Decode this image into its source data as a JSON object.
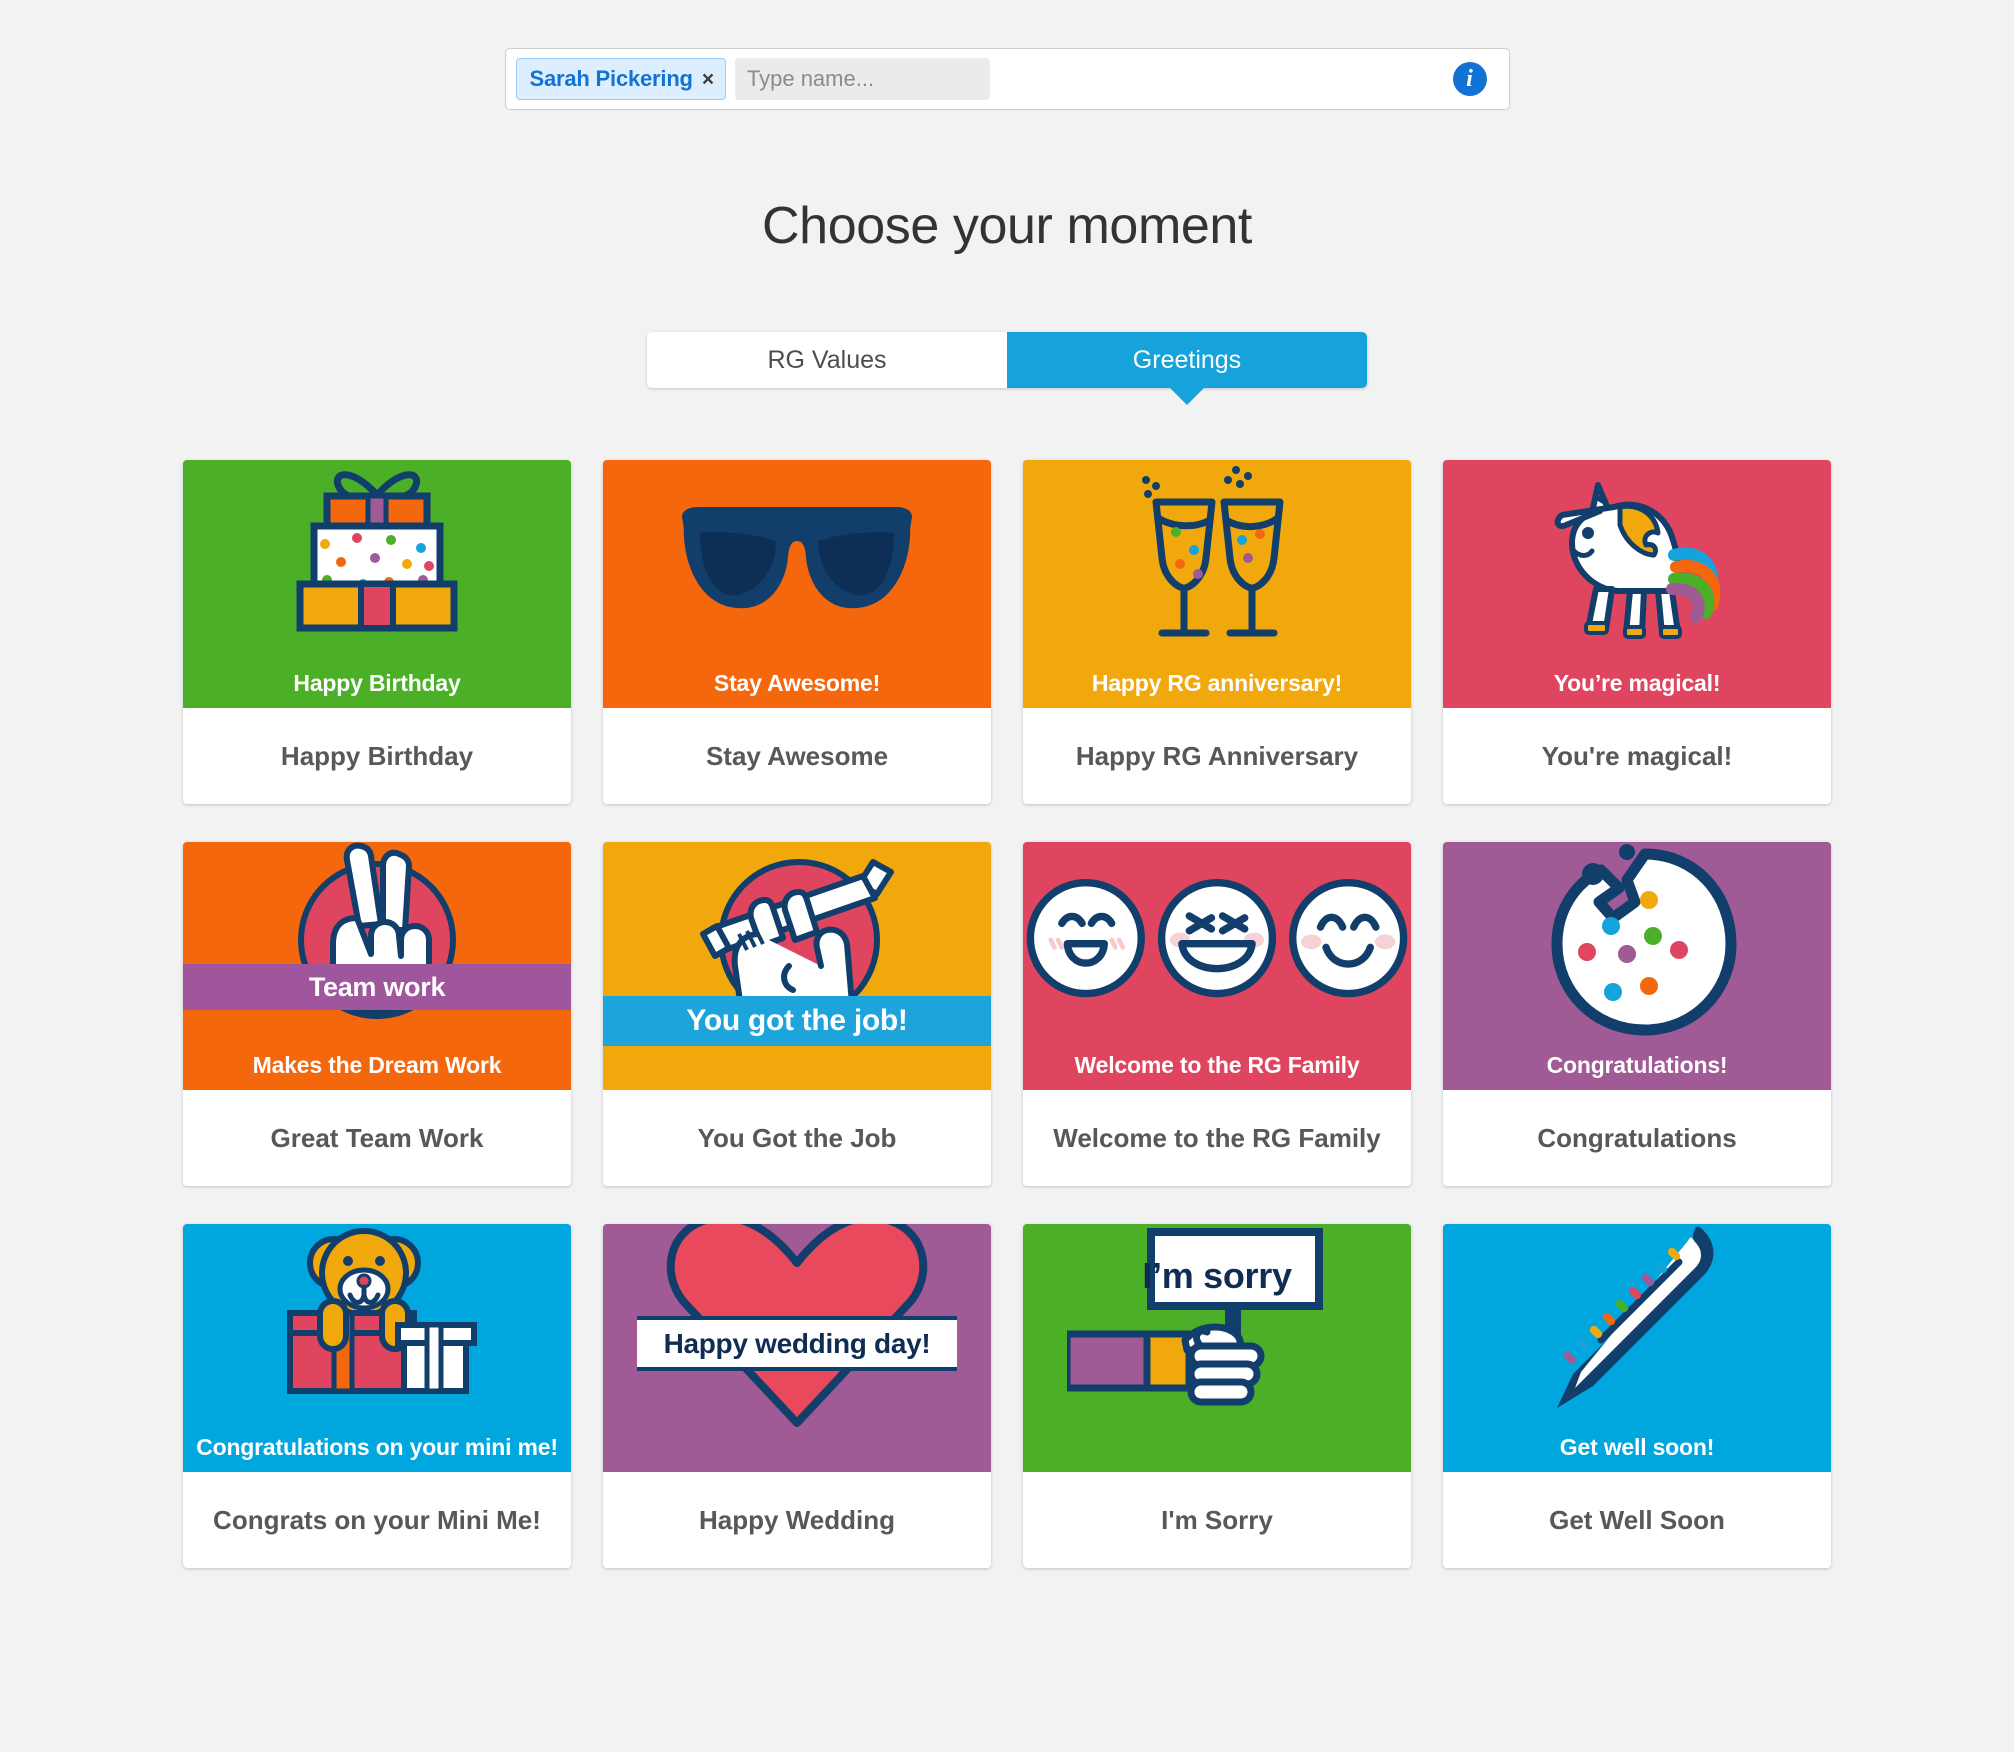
{
  "recipient_bar": {
    "chip_name": "Sarah Pickering",
    "chip_remove_glyph": "×",
    "input_placeholder": "Type name...",
    "input_value": "",
    "info_glyph": "i"
  },
  "page_title": "Choose your moment",
  "tabs": [
    {
      "label": "RG Values",
      "active": false
    },
    {
      "label": "Greetings",
      "active": true
    }
  ],
  "colors": {
    "page_bg": "#f2f2f2",
    "accent_blue": "#16a3dc",
    "chip_blue": "#1273d4",
    "ink_navy": "#123e6b",
    "green": "#4caf28",
    "orange": "#f4670c",
    "amber": "#f0a80c",
    "crimson": "#e04560",
    "purple": "#a05a96",
    "sky": "#00a6de"
  },
  "cards": [
    {
      "label": "Happy Birthday",
      "caption": "Happy Birthday",
      "bg": "#4caf28",
      "art": "gift-stack-icon"
    },
    {
      "label": "Stay Awesome",
      "caption": "Stay Awesome!",
      "bg": "#f4670c",
      "art": "sunglasses-icon"
    },
    {
      "label": "Happy RG Anniversary",
      "caption": "Happy RG anniversary!",
      "bg": "#f0a80c",
      "art": "champagne-glasses-icon"
    },
    {
      "label": "You're magical!",
      "caption": "You’re magical!",
      "bg": "#e04560",
      "art": "unicorn-icon"
    },
    {
      "label": "Great Team Work",
      "caption": "Makes the Dream Work",
      "bg": "#f4670c",
      "art": "peace-hand-icon",
      "banner": "Team work"
    },
    {
      "label": "You Got the Job",
      "caption": "",
      "bg": "#f0a80c",
      "art": "fist-pencil-icon",
      "banner": "You got the job!"
    },
    {
      "label": "Welcome to the RG Family",
      "caption": "Welcome to the RG Family",
      "bg": "#e04560",
      "art": "three-smileys-icon"
    },
    {
      "label": "Congratulations",
      "caption": "Congratulations!",
      "bg": "#a05a96",
      "art": "cookie-icon"
    },
    {
      "label": "Congrats on your Mini Me!",
      "caption": "Congratulations on your mini me!",
      "bg": "#00a6de",
      "art": "teddy-gift-icon"
    },
    {
      "label": "Happy Wedding",
      "caption": "",
      "bg": "#a05a96",
      "art": "heart-icon",
      "banner": "Happy wedding day!"
    },
    {
      "label": "I'm Sorry",
      "caption": "",
      "bg": "#4caf28",
      "art": "sorry-sign-icon",
      "banner": "I’m sorry"
    },
    {
      "label": "Get Well Soon",
      "caption": "Get well soon!",
      "bg": "#00a6de",
      "art": "thermometer-icon"
    }
  ]
}
